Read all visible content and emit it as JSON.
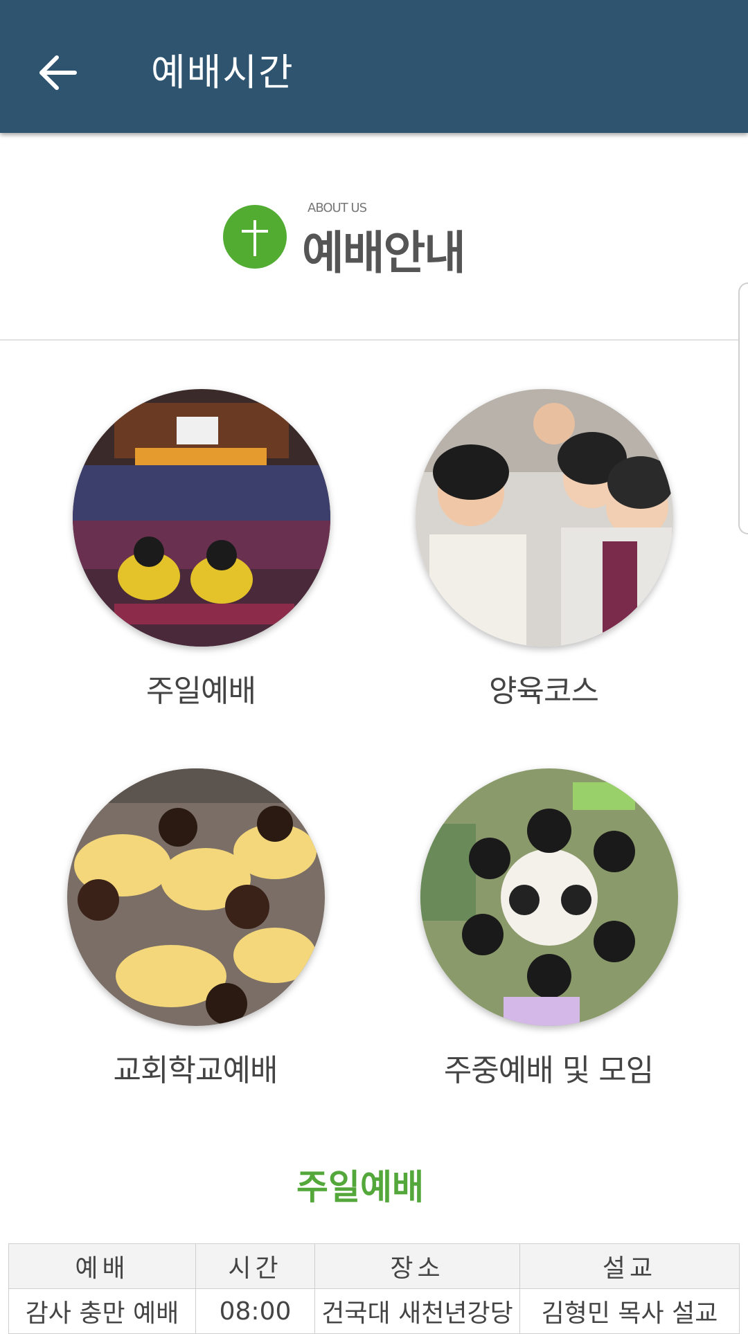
{
  "appbar": {
    "title": "예배시간",
    "back_icon": "arrow-left-icon"
  },
  "hero": {
    "logo_icon": "cross-icon",
    "small_label": "ABOUT US",
    "title": "예배안내"
  },
  "tiles": [
    {
      "label": "주일예배",
      "image": "auditorium-photo"
    },
    {
      "label": "양육코스",
      "image": "smiling-congregation-photo"
    },
    {
      "label": "교회학교예배",
      "image": "children-praying-photo"
    },
    {
      "label": "주중예배 및 모임",
      "image": "group-huddle-photo"
    }
  ],
  "section": {
    "title": "주일예배"
  },
  "table": {
    "headers": [
      "예배",
      "시간",
      "장소",
      "설교"
    ],
    "rows": [
      [
        "감사 충만 예배",
        "08:00",
        "건국대 새천년강당",
        "김형민 목사 설교"
      ]
    ]
  },
  "colors": {
    "appbar": "#2e5470",
    "accent_green": "#54a73a",
    "logo_green": "#52ac32"
  }
}
